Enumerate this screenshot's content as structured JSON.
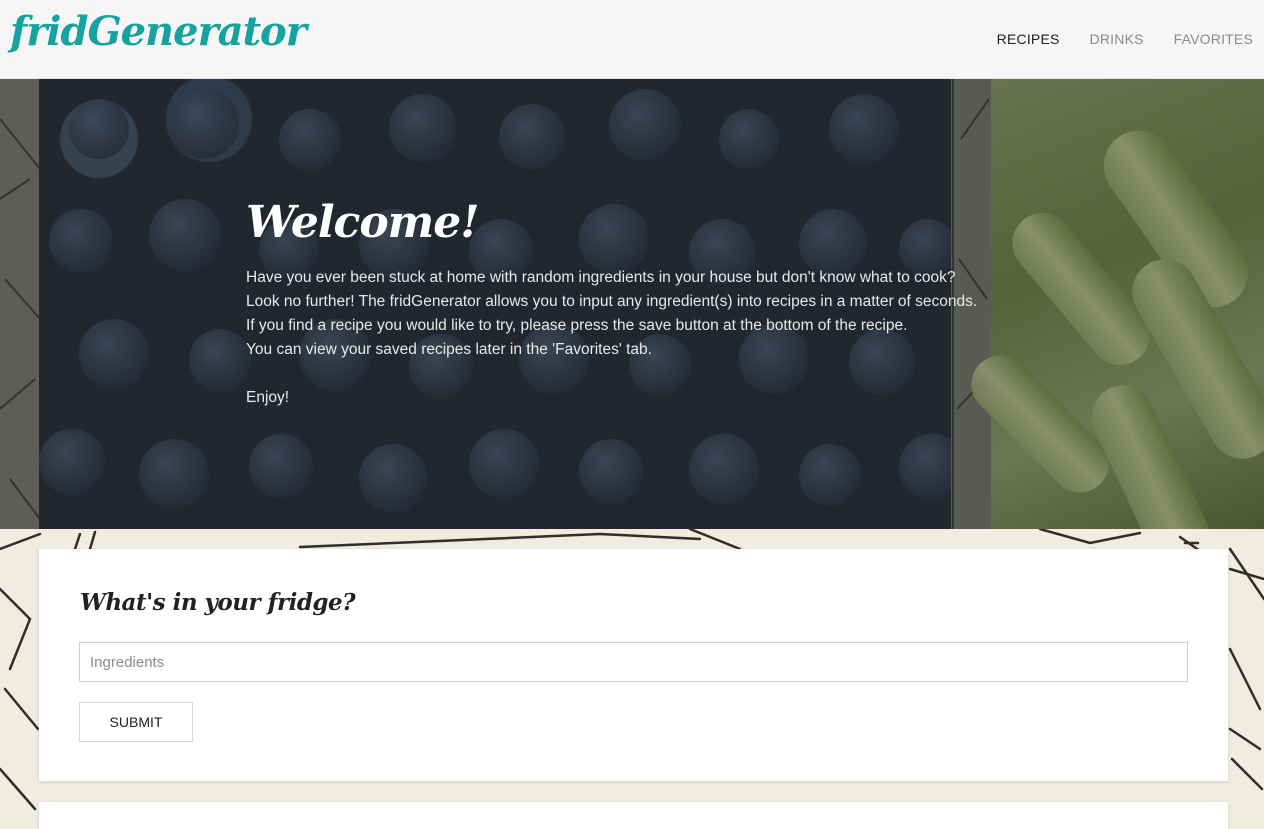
{
  "brand": {
    "name": "fridGenerator",
    "color": "#16a3a0"
  },
  "nav": {
    "items": [
      {
        "label": "RECIPES",
        "active": true
      },
      {
        "label": "DRINKS",
        "active": false
      },
      {
        "label": "FAVORITES",
        "active": false
      }
    ]
  },
  "hero": {
    "heading": "Welcome!",
    "lines": [
      "Have you ever been stuck at home with random ingredients in your house but don't know what to cook?",
      "Look no further! The fridGenerator allows you to input any ingredient(s) into recipes in a matter of seconds.",
      "If you find a recipe you would like to try, please press the save button at the bottom of the recipe.",
      "You can view your saved recipes later in the 'Favorites' tab."
    ],
    "closing": "Enjoy!"
  },
  "search_card": {
    "title": "What's in your fridge?",
    "input_placeholder": "Ingredients",
    "input_value": "",
    "submit_label": "SUBMIT"
  }
}
